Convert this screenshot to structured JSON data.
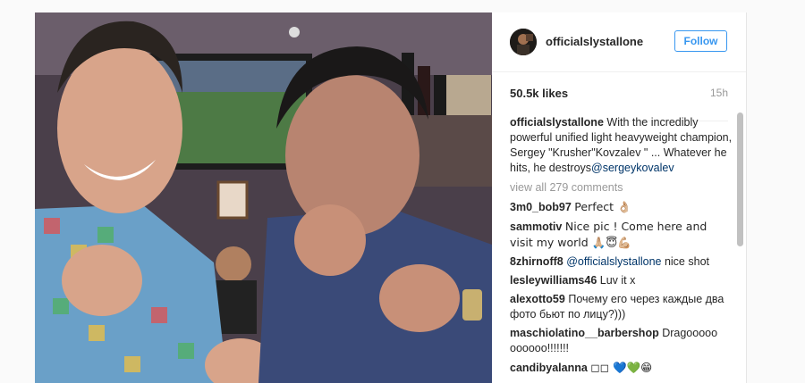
{
  "header": {
    "username": "officialslystallone",
    "follow_label": "Follow"
  },
  "stats": {
    "likes": "50.5k likes",
    "time": "15h"
  },
  "caption": {
    "user": "officialslystallone",
    "text": "With the incredibly powerful unified light heavyweight champion, Sergey \"Krusher\"Kovzalev \" ... Whatever he hits, he destroys",
    "mention": "@sergeykovalev"
  },
  "view_all": "view all 279 comments",
  "comments": [
    {
      "user": "3m0_bob97",
      "text": "Perfect 👌🏼"
    },
    {
      "user": "sammotiv",
      "text": "Nice pic ! Come here and visit my world 🙏🏼😇💪🏼"
    },
    {
      "user": "8zhirnoff8",
      "mention": "@officialslystallone",
      "text": " nice shot"
    },
    {
      "user": "lesleywilliams46",
      "text": "Luv it x"
    },
    {
      "user": "alexotto59",
      "text": "Почему его через каждые два фото бьют по лицу?)))"
    },
    {
      "user": "maschiolatino__barbershop",
      "text": "Dragooooo oooooo!!!!!!!"
    },
    {
      "user": "candibyalanna",
      "text": "◻◻ 💙💚😁"
    }
  ],
  "icons": {
    "avatar": "profile-avatar",
    "photo": "post-photo"
  },
  "colors": {
    "follow": "#3897f0",
    "mention": "#003569",
    "muted": "#999999"
  }
}
